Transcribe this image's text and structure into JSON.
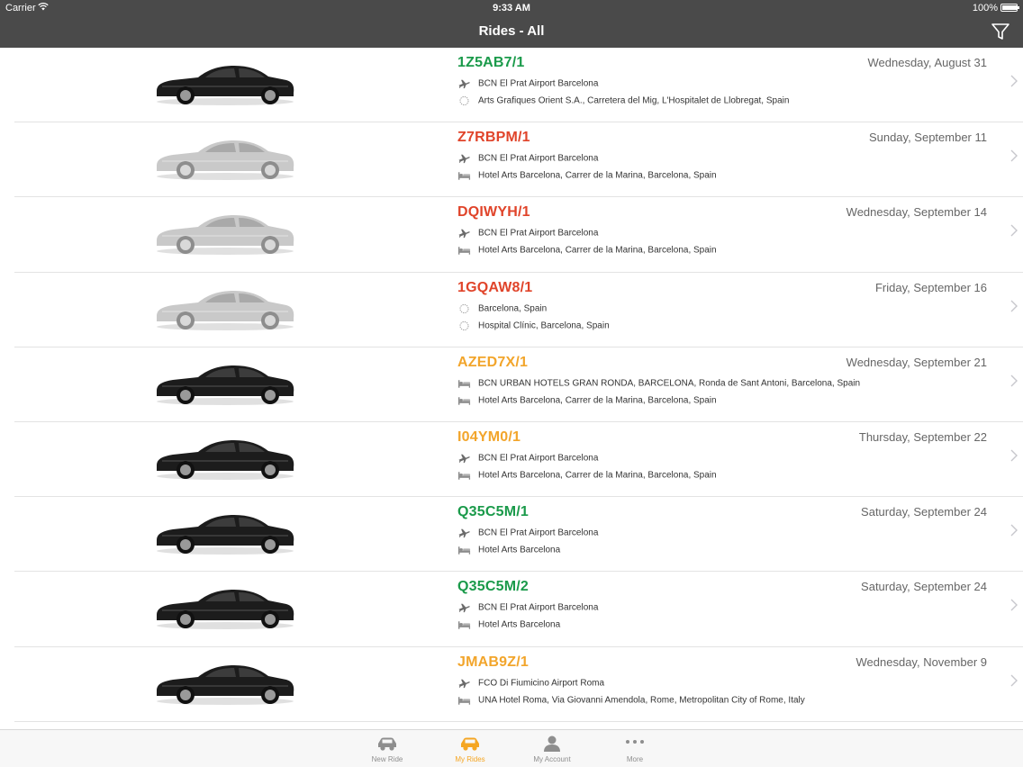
{
  "status_bar": {
    "carrier": "Carrier",
    "time": "9:33 AM",
    "battery": "100%",
    "battery_level": 1.0
  },
  "nav": {
    "title": "Rides - All",
    "filter_icon": "filter-icon"
  },
  "colors": {
    "green": "#1a9a4a",
    "red": "#e0442a",
    "orange": "#f2a52b"
  },
  "rides": [
    {
      "code": "1Z5AB7/1",
      "status": "green",
      "date": "Wednesday, August 31",
      "car": "dark",
      "from_icon": "plane-icon",
      "from": "BCN El Prat Airport Barcelona",
      "to_icon": "location-icon",
      "to": "Arts Grafiques Orient S.A., Carretera del Mig, L'Hospitalet de Llobregat, Spain"
    },
    {
      "code": "Z7RBPM/1",
      "status": "red",
      "date": "Sunday, September 11",
      "car": "faded",
      "from_icon": "plane-icon",
      "from": "BCN El Prat Airport Barcelona",
      "to_icon": "bed-icon",
      "to": "Hotel Arts Barcelona, Carrer de la Marina, Barcelona, Spain"
    },
    {
      "code": "DQIWYH/1",
      "status": "red",
      "date": "Wednesday, September 14",
      "car": "faded",
      "from_icon": "plane-icon",
      "from": "BCN El Prat Airport Barcelona",
      "to_icon": "bed-icon",
      "to": "Hotel Arts Barcelona, Carrer de la Marina, Barcelona, Spain"
    },
    {
      "code": "1GQAW8/1",
      "status": "red",
      "date": "Friday, September 16",
      "car": "faded",
      "from_icon": "location-icon",
      "from": "Barcelona, Spain",
      "to_icon": "location-icon",
      "to": "Hospital Clínic, Barcelona, Spain"
    },
    {
      "code": "AZED7X/1",
      "status": "orange",
      "date": "Wednesday, September 21",
      "car": "dark",
      "from_icon": "bed-icon",
      "from": "BCN URBAN HOTELS GRAN RONDA, BARCELONA, Ronda de Sant Antoni, Barcelona, Spain",
      "to_icon": "bed-icon",
      "to": "Hotel Arts Barcelona, Carrer de la Marina, Barcelona, Spain"
    },
    {
      "code": "I04YM0/1",
      "status": "orange",
      "date": "Thursday, September 22",
      "car": "dark",
      "from_icon": "plane-icon",
      "from": "BCN El Prat Airport Barcelona",
      "to_icon": "bed-icon",
      "to": "Hotel Arts Barcelona, Carrer de la Marina, Barcelona, Spain"
    },
    {
      "code": "Q35C5M/1",
      "status": "green",
      "date": "Saturday, September 24",
      "car": "dark",
      "from_icon": "plane-icon",
      "from": "BCN El Prat Airport Barcelona",
      "to_icon": "bed-icon",
      "to": "Hotel Arts  Barcelona"
    },
    {
      "code": "Q35C5M/2",
      "status": "green",
      "date": "Saturday, September 24",
      "car": "dark",
      "from_icon": "plane-icon",
      "from": "BCN El Prat Airport Barcelona",
      "to_icon": "bed-icon",
      "to": "Hotel Arts  Barcelona"
    },
    {
      "code": "JMAB9Z/1",
      "status": "orange",
      "date": "Wednesday, November 9",
      "car": "dark",
      "from_icon": "plane-icon",
      "from": "FCO Di Fiumicino Airport Roma",
      "to_icon": "bed-icon",
      "to": "UNA Hotel Roma, Via Giovanni Amendola, Rome, Metropolitan City of Rome, Italy"
    }
  ],
  "tabs": [
    {
      "label": "New Ride",
      "icon": "car-icon",
      "active": false
    },
    {
      "label": "My Rides",
      "icon": "car-icon",
      "active": true
    },
    {
      "label": "My Account",
      "icon": "person-icon",
      "active": false
    },
    {
      "label": "More",
      "icon": "more-icon",
      "active": false
    }
  ]
}
